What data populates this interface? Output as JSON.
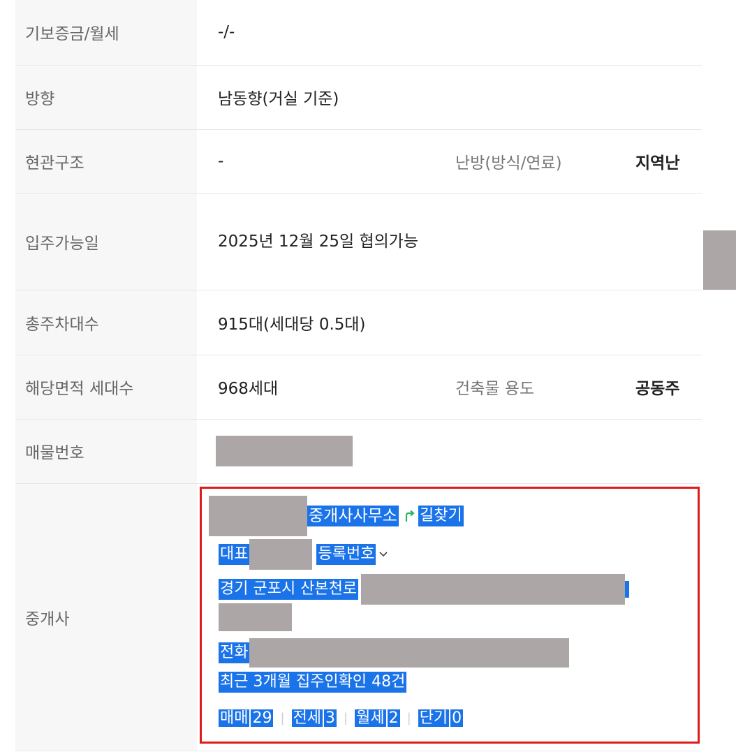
{
  "rows": [
    {
      "label": "기보증금/월세",
      "value": "-/-"
    },
    {
      "label": "방향",
      "value": "남동향(거실 기준)"
    },
    {
      "label": "현관구조",
      "value": "-",
      "label2": "난방(방식/연료)",
      "value2": "지역난"
    },
    {
      "label": "입주가능일",
      "value": "2025년 12월 25일 협의가능"
    },
    {
      "label": "총주차대수",
      "value": "915대(세대당 0.5대)"
    },
    {
      "label": "해당면적 세대수",
      "value": "968세대",
      "label2": "건축물 용도",
      "value2": "공동주"
    },
    {
      "label": "매물번호",
      "value": ""
    },
    {
      "label": "중개사"
    }
  ],
  "broker": {
    "office_suffix": "중개사사무소",
    "directions_link": "길찾기",
    "representative_label": "대표",
    "registration_label": "등록번호",
    "address_prefix": "경기 군포시 산본천로",
    "phone_label": "전화",
    "recent_confirm": "최근 3개월 집주인확인 48건",
    "counts": [
      {
        "label": "매매",
        "value": "29"
      },
      {
        "label": "전세",
        "value": "3"
      },
      {
        "label": "월세",
        "value": "2"
      },
      {
        "label": "단기",
        "value": "0"
      }
    ],
    "colors": {
      "highlight": "#1a73e8",
      "border": "#e01a1a",
      "redaction": "#ada6a6",
      "arrow": "#2fb36a"
    }
  }
}
